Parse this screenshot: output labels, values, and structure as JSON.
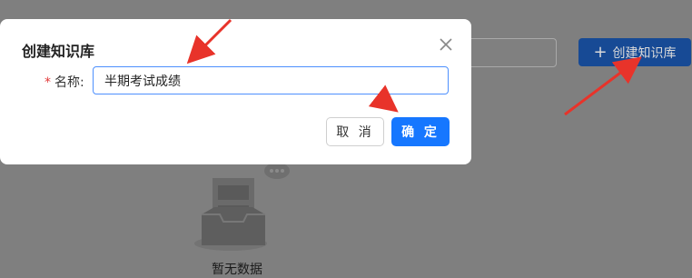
{
  "background": {
    "create_button_label": "创建知识库",
    "empty_text": "暂无数据"
  },
  "dialog": {
    "title": "创建知识库",
    "name_label": "名称:",
    "name_value": "半期考试成绩",
    "cancel_label": "取 消",
    "ok_label": "确 定"
  },
  "colors": {
    "primary": "#1677ff",
    "required": "#e23a3a",
    "annotation_arrow": "#e8332a"
  }
}
